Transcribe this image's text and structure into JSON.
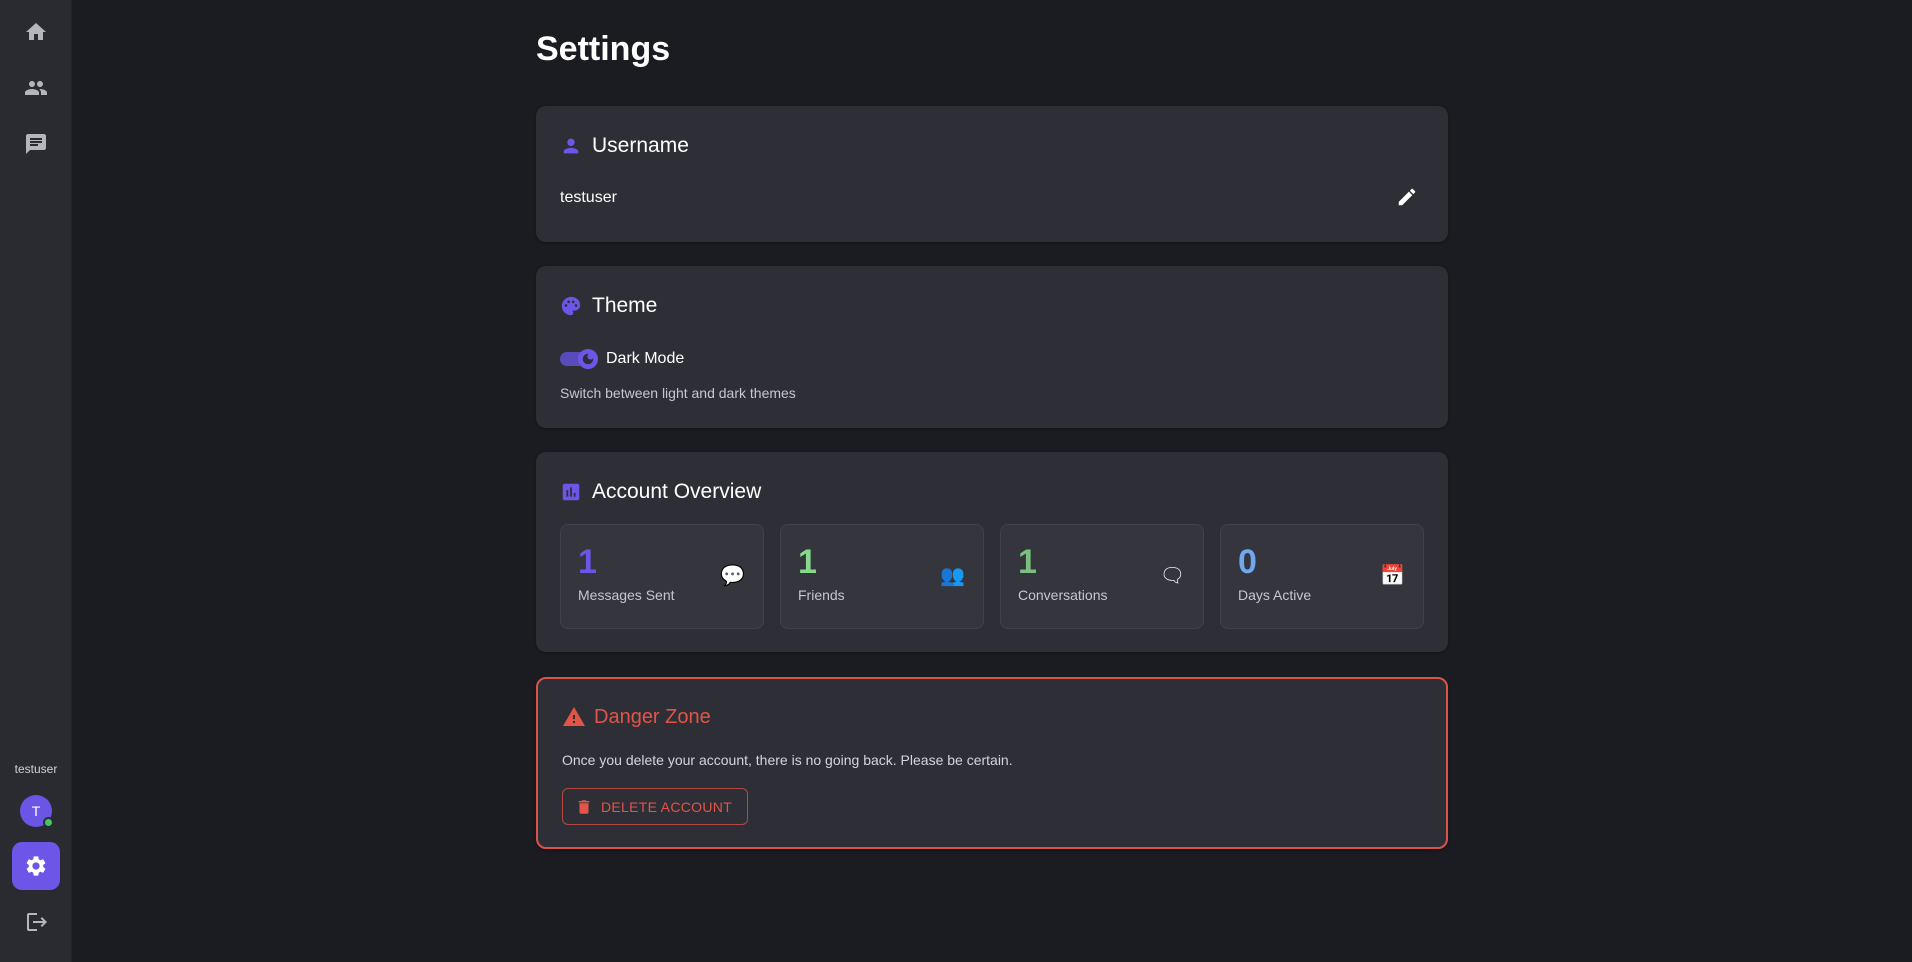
{
  "sidebar": {
    "nav": [
      {
        "icon": "home-icon",
        "name": "home"
      },
      {
        "icon": "people-icon",
        "name": "friends"
      },
      {
        "icon": "chat-icon",
        "name": "messages"
      }
    ],
    "username": "testuser",
    "avatar_initial": "T",
    "settings_icon": "gear-icon",
    "logout_icon": "logout-icon"
  },
  "page": {
    "title": "Settings"
  },
  "username_card": {
    "title": "Username",
    "value": "testuser",
    "icon": "person-icon",
    "edit_icon": "pencil-icon"
  },
  "theme_card": {
    "title": "Theme",
    "icon": "palette-icon",
    "toggle_label": "Dark Mode",
    "toggle_on": true,
    "description": "Switch between light and dark themes"
  },
  "overview_card": {
    "title": "Account Overview",
    "icon": "bar-chart-icon",
    "stats": [
      {
        "value": "1",
        "label": "Messages Sent",
        "emoji": "💬",
        "color": "#6d55e8"
      },
      {
        "value": "1",
        "label": "Friends",
        "emoji": "👥",
        "color": "#86d98c"
      },
      {
        "value": "1",
        "label": "Conversations",
        "emoji": "🗨",
        "color": "#7bc07f"
      },
      {
        "value": "0",
        "label": "Days Active",
        "emoji": "📅",
        "color": "#6fa8f0"
      }
    ]
  },
  "danger_card": {
    "title": "Danger Zone",
    "icon": "warning-icon",
    "description": "Once you delete your account, there is no going back. Please be certain.",
    "delete_label": "DELETE ACCOUNT",
    "delete_icon": "trash-icon"
  },
  "colors": {
    "accent": "#6d55e8",
    "danger": "#e05548",
    "background": "#1b1c21",
    "card": "#2e2f36"
  }
}
